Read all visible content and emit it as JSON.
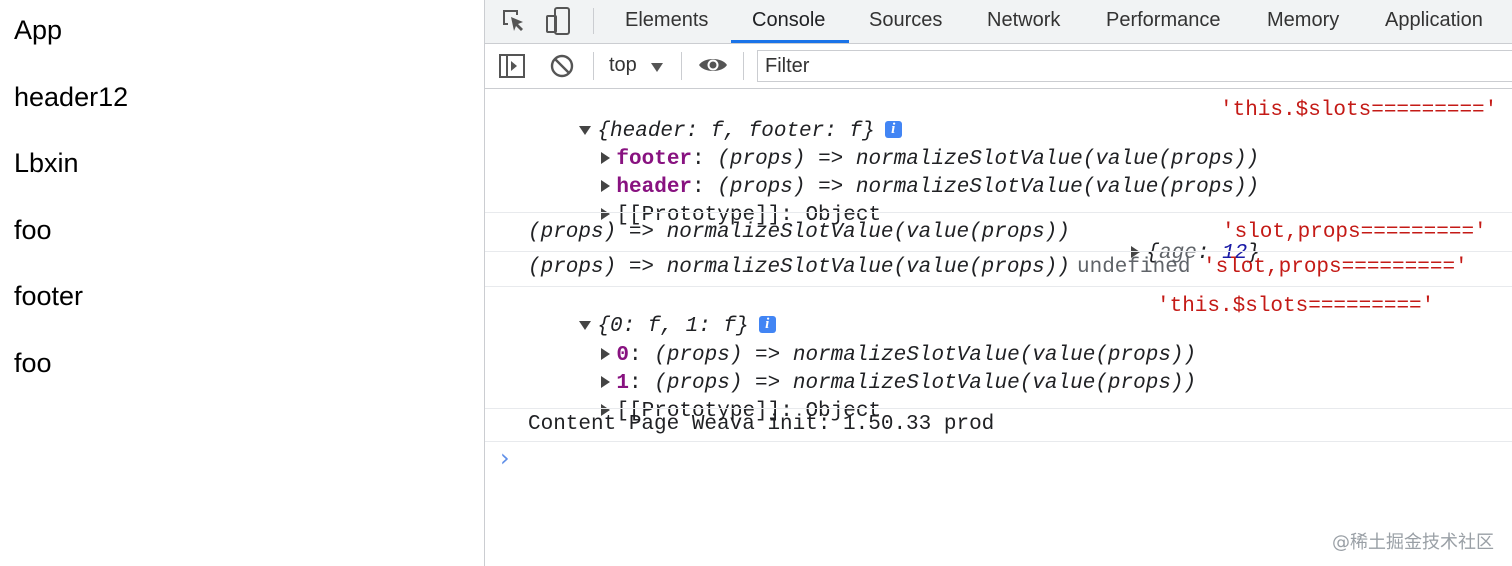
{
  "page": {
    "items": [
      "App",
      "header12",
      "Lbxin",
      "foo",
      "footer",
      "foo"
    ]
  },
  "devtools": {
    "tabs": [
      "Elements",
      "Console",
      "Sources",
      "Network",
      "Performance",
      "Memory",
      "Application"
    ],
    "active_tab": "Console",
    "icons": [
      "inspect-element-icon",
      "device-toolbar-icon",
      "sidebar-toggle-icon",
      "clear-console-icon",
      "eye-icon",
      "dropdown-arrow-icon"
    ],
    "context": "top",
    "filter_placeholder": "Filter"
  },
  "console": {
    "log1": {
      "summary": "{header: f, footer: f}",
      "label": "'this.$slots========='",
      "props": [
        {
          "key": "footer",
          "value": " (props) => normalizeSlotValue(value(props))"
        },
        {
          "key": "header",
          "value": " (props) => normalizeSlotValue(value(props))"
        }
      ],
      "proto": "[[Prototype]]: Object"
    },
    "log2": {
      "fn": "(props) => normalizeSlotValue(value(props))",
      "obj_open": "{",
      "obj_key": "age",
      "obj_sep": ": ",
      "obj_val": "12",
      "obj_close": "}",
      "label": "'slot,props========='"
    },
    "log3": {
      "fn": "(props) => normalizeSlotValue(value(props))",
      "undef": "undefined",
      "label": "'slot,props========='"
    },
    "log4": {
      "summary": "{0: f, 1: f}",
      "label": "'this.$slots========='",
      "props": [
        {
          "key": "0",
          "value": " (props) => normalizeSlotValue(value(props))"
        },
        {
          "key": "1",
          "value": " (props) => normalizeSlotValue(value(props))"
        }
      ],
      "proto": "[[Prototype]]: Object"
    },
    "log5": "Content Page Weava init: 1.50.33 prod",
    "prompt": "›"
  },
  "watermark": "@稀土掘金技术社区"
}
